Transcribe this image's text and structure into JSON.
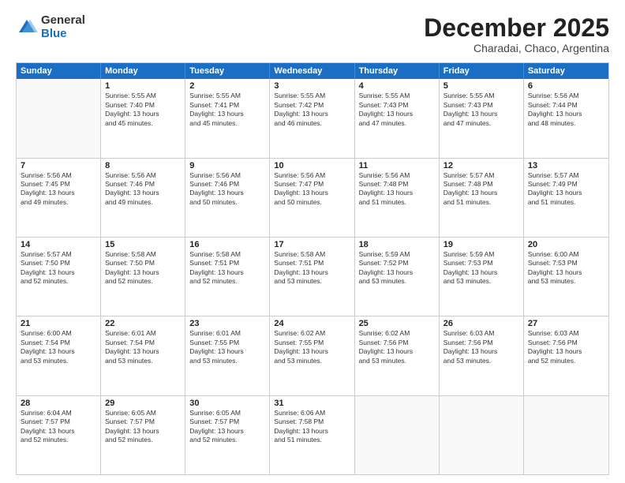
{
  "logo": {
    "general": "General",
    "blue": "Blue"
  },
  "title": "December 2025",
  "location": "Charadai, Chaco, Argentina",
  "days": [
    "Sunday",
    "Monday",
    "Tuesday",
    "Wednesday",
    "Thursday",
    "Friday",
    "Saturday"
  ],
  "rows": [
    [
      {
        "day": "",
        "empty": true
      },
      {
        "day": "1",
        "lines": [
          "Sunrise: 5:55 AM",
          "Sunset: 7:40 PM",
          "Daylight: 13 hours",
          "and 45 minutes."
        ]
      },
      {
        "day": "2",
        "lines": [
          "Sunrise: 5:55 AM",
          "Sunset: 7:41 PM",
          "Daylight: 13 hours",
          "and 45 minutes."
        ]
      },
      {
        "day": "3",
        "lines": [
          "Sunrise: 5:55 AM",
          "Sunset: 7:42 PM",
          "Daylight: 13 hours",
          "and 46 minutes."
        ]
      },
      {
        "day": "4",
        "lines": [
          "Sunrise: 5:55 AM",
          "Sunset: 7:43 PM",
          "Daylight: 13 hours",
          "and 47 minutes."
        ]
      },
      {
        "day": "5",
        "lines": [
          "Sunrise: 5:55 AM",
          "Sunset: 7:43 PM",
          "Daylight: 13 hours",
          "and 47 minutes."
        ]
      },
      {
        "day": "6",
        "lines": [
          "Sunrise: 5:56 AM",
          "Sunset: 7:44 PM",
          "Daylight: 13 hours",
          "and 48 minutes."
        ]
      }
    ],
    [
      {
        "day": "7",
        "lines": [
          "Sunrise: 5:56 AM",
          "Sunset: 7:45 PM",
          "Daylight: 13 hours",
          "and 49 minutes."
        ]
      },
      {
        "day": "8",
        "lines": [
          "Sunrise: 5:56 AM",
          "Sunset: 7:46 PM",
          "Daylight: 13 hours",
          "and 49 minutes."
        ]
      },
      {
        "day": "9",
        "lines": [
          "Sunrise: 5:56 AM",
          "Sunset: 7:46 PM",
          "Daylight: 13 hours",
          "and 50 minutes."
        ]
      },
      {
        "day": "10",
        "lines": [
          "Sunrise: 5:56 AM",
          "Sunset: 7:47 PM",
          "Daylight: 13 hours",
          "and 50 minutes."
        ]
      },
      {
        "day": "11",
        "lines": [
          "Sunrise: 5:56 AM",
          "Sunset: 7:48 PM",
          "Daylight: 13 hours",
          "and 51 minutes."
        ]
      },
      {
        "day": "12",
        "lines": [
          "Sunrise: 5:57 AM",
          "Sunset: 7:48 PM",
          "Daylight: 13 hours",
          "and 51 minutes."
        ]
      },
      {
        "day": "13",
        "lines": [
          "Sunrise: 5:57 AM",
          "Sunset: 7:49 PM",
          "Daylight: 13 hours",
          "and 51 minutes."
        ]
      }
    ],
    [
      {
        "day": "14",
        "lines": [
          "Sunrise: 5:57 AM",
          "Sunset: 7:50 PM",
          "Daylight: 13 hours",
          "and 52 minutes."
        ]
      },
      {
        "day": "15",
        "lines": [
          "Sunrise: 5:58 AM",
          "Sunset: 7:50 PM",
          "Daylight: 13 hours",
          "and 52 minutes."
        ]
      },
      {
        "day": "16",
        "lines": [
          "Sunrise: 5:58 AM",
          "Sunset: 7:51 PM",
          "Daylight: 13 hours",
          "and 52 minutes."
        ]
      },
      {
        "day": "17",
        "lines": [
          "Sunrise: 5:58 AM",
          "Sunset: 7:51 PM",
          "Daylight: 13 hours",
          "and 53 minutes."
        ]
      },
      {
        "day": "18",
        "lines": [
          "Sunrise: 5:59 AM",
          "Sunset: 7:52 PM",
          "Daylight: 13 hours",
          "and 53 minutes."
        ]
      },
      {
        "day": "19",
        "lines": [
          "Sunrise: 5:59 AM",
          "Sunset: 7:53 PM",
          "Daylight: 13 hours",
          "and 53 minutes."
        ]
      },
      {
        "day": "20",
        "lines": [
          "Sunrise: 6:00 AM",
          "Sunset: 7:53 PM",
          "Daylight: 13 hours",
          "and 53 minutes."
        ]
      }
    ],
    [
      {
        "day": "21",
        "lines": [
          "Sunrise: 6:00 AM",
          "Sunset: 7:54 PM",
          "Daylight: 13 hours",
          "and 53 minutes."
        ]
      },
      {
        "day": "22",
        "lines": [
          "Sunrise: 6:01 AM",
          "Sunset: 7:54 PM",
          "Daylight: 13 hours",
          "and 53 minutes."
        ]
      },
      {
        "day": "23",
        "lines": [
          "Sunrise: 6:01 AM",
          "Sunset: 7:55 PM",
          "Daylight: 13 hours",
          "and 53 minutes."
        ]
      },
      {
        "day": "24",
        "lines": [
          "Sunrise: 6:02 AM",
          "Sunset: 7:55 PM",
          "Daylight: 13 hours",
          "and 53 minutes."
        ]
      },
      {
        "day": "25",
        "lines": [
          "Sunrise: 6:02 AM",
          "Sunset: 7:56 PM",
          "Daylight: 13 hours",
          "and 53 minutes."
        ]
      },
      {
        "day": "26",
        "lines": [
          "Sunrise: 6:03 AM",
          "Sunset: 7:56 PM",
          "Daylight: 13 hours",
          "and 53 minutes."
        ]
      },
      {
        "day": "27",
        "lines": [
          "Sunrise: 6:03 AM",
          "Sunset: 7:56 PM",
          "Daylight: 13 hours",
          "and 52 minutes."
        ]
      }
    ],
    [
      {
        "day": "28",
        "lines": [
          "Sunrise: 6:04 AM",
          "Sunset: 7:57 PM",
          "Daylight: 13 hours",
          "and 52 minutes."
        ]
      },
      {
        "day": "29",
        "lines": [
          "Sunrise: 6:05 AM",
          "Sunset: 7:57 PM",
          "Daylight: 13 hours",
          "and 52 minutes."
        ]
      },
      {
        "day": "30",
        "lines": [
          "Sunrise: 6:05 AM",
          "Sunset: 7:57 PM",
          "Daylight: 13 hours",
          "and 52 minutes."
        ]
      },
      {
        "day": "31",
        "lines": [
          "Sunrise: 6:06 AM",
          "Sunset: 7:58 PM",
          "Daylight: 13 hours",
          "and 51 minutes."
        ]
      },
      {
        "day": "",
        "empty": true
      },
      {
        "day": "",
        "empty": true
      },
      {
        "day": "",
        "empty": true
      }
    ]
  ]
}
